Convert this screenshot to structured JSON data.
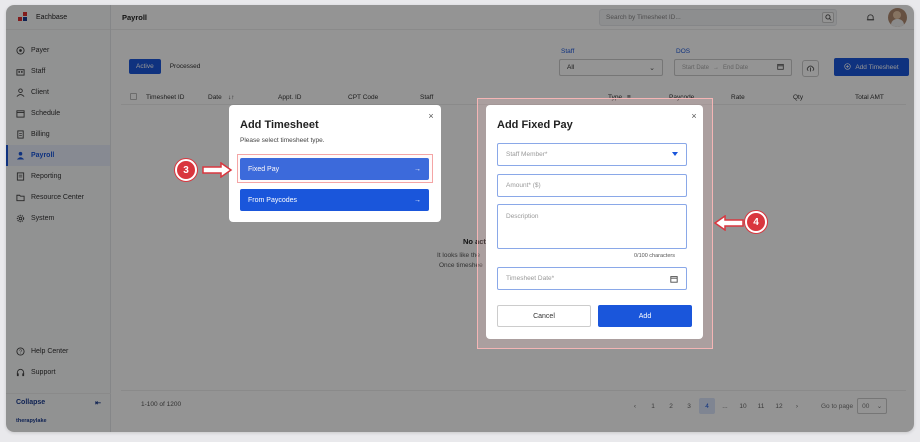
{
  "sidebar": {
    "brand": "Eachbase",
    "items": [
      {
        "label": "Payer",
        "icon": "shield-icon"
      },
      {
        "label": "Staff",
        "icon": "users-icon"
      },
      {
        "label": "Client",
        "icon": "user-icon"
      },
      {
        "label": "Schedule",
        "icon": "calendar-icon"
      },
      {
        "label": "Billing",
        "icon": "billing-icon"
      },
      {
        "label": "Payroll",
        "icon": "payroll-icon"
      },
      {
        "label": "Reporting",
        "icon": "report-icon"
      },
      {
        "label": "Resource Center",
        "icon": "folder-icon"
      },
      {
        "label": "System",
        "icon": "gear-icon"
      }
    ],
    "bottom": [
      {
        "label": "Help Center",
        "icon": "help-icon"
      },
      {
        "label": "Support",
        "icon": "headset-icon"
      }
    ],
    "collapse": "Collapse",
    "footer_brand": "therapylake"
  },
  "header": {
    "title": "Payroll",
    "search_placeholder": "Search by Timesheet ID..."
  },
  "tabs": {
    "active": "Active",
    "processed": "Processed"
  },
  "filters": {
    "staff_label": "Staff",
    "staff_value": "All",
    "dos_label": "DOS",
    "start_date": "Start Date",
    "end_date": "End Date",
    "add_label": "Add Timesheet"
  },
  "table": {
    "headers": [
      "Timesheet ID",
      "Date",
      "Appt. ID",
      "CPT Code",
      "Staff",
      "Type",
      "Paycode",
      "Rate",
      "Qty",
      "Total AMT"
    ]
  },
  "empty": {
    "title": "No act",
    "line1": "It looks like the",
    "line2": "Once timeshee"
  },
  "pagination": {
    "summary": "1-100 of 1200",
    "pages": [
      "1",
      "2",
      "3",
      "4",
      "...",
      "10",
      "11",
      "12"
    ],
    "current": "4",
    "goto_label": "Go to page",
    "goto_value": "00"
  },
  "modal_timesheet": {
    "title": "Add Timesheet",
    "subtitle": "Please select timesheet type.",
    "option1": "Fixed Pay",
    "option2": "From Paycodes"
  },
  "modal_fixed": {
    "title": "Add Fixed Pay",
    "staff_placeholder": "Staff Member*",
    "amount_placeholder": "Amount* ($)",
    "description_placeholder": "Description",
    "counter": "0/100 characters",
    "date_placeholder": "Timesheet Date*",
    "cancel": "Cancel",
    "add": "Add"
  },
  "callouts": {
    "step3": "3",
    "step4": "4"
  },
  "colors": {
    "primary": "#1a56db",
    "callout": "#d9363e"
  }
}
